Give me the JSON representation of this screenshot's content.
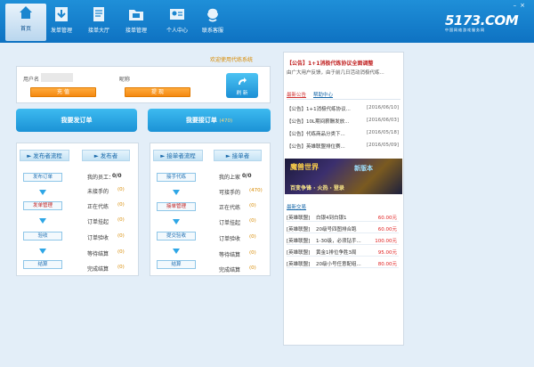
{
  "nav": [
    {
      "label": "首页",
      "icon": "home-icon"
    },
    {
      "label": "发单管理",
      "icon": "download-arrow-icon"
    },
    {
      "label": "接单大厅",
      "icon": "document-icon"
    },
    {
      "label": "接单管理",
      "icon": "folder-icon"
    },
    {
      "label": "个人中心",
      "icon": "id-card-icon"
    },
    {
      "label": "联系客服",
      "icon": "customer-service-icon"
    }
  ],
  "logo": {
    "text": "5173.COM",
    "tagline": "中国网络游戏服务网"
  },
  "welcome": "欢迎使用代练系统",
  "account": {
    "username_label": "用户名",
    "nickname_label": "昵称",
    "recharge_label": "充 值",
    "withdraw_label": "提 现",
    "refresh_label": "刷 新"
  },
  "big_buttons": {
    "publish": "我要发订单",
    "accept": "我要接订单",
    "accept_count": "(470)"
  },
  "publisher": {
    "header_flow": "发布者流程",
    "header_role": "发布者",
    "steps": [
      "发布订单",
      "发单管理",
      "验收",
      "结算"
    ],
    "stats": [
      {
        "label": "我的员工：",
        "value": "0/0"
      },
      {
        "label": "未接手的",
        "value": "(0)"
      },
      {
        "label": "正在代练",
        "value": "(0)"
      },
      {
        "label": "订单挂起",
        "value": "(0)"
      },
      {
        "label": "订单验收",
        "value": "(0)"
      },
      {
        "label": "等待结算",
        "value": "(0)"
      },
      {
        "label": "完成结算",
        "value": "(0)"
      }
    ]
  },
  "acceptor": {
    "header_flow": "接单者流程",
    "header_role": "接单者",
    "steps": [
      "接手代练",
      "接单管理",
      "提交验收",
      "结算"
    ],
    "stats": [
      {
        "label": "我的上家",
        "value": "0/0"
      },
      {
        "label": "可接手的",
        "value": "(470)"
      },
      {
        "label": "正在代练",
        "value": "(0)"
      },
      {
        "label": "订单挂起",
        "value": "(0)"
      },
      {
        "label": "订单验收",
        "value": "(0)"
      },
      {
        "label": "等待结算",
        "value": "(0)"
      },
      {
        "label": "完成结算",
        "value": "(0)"
      }
    ]
  },
  "notice": {
    "headline": "【公告】1+1消极代练协议全面调整",
    "subline": "由广大用户反馈，由于前几日活动消极代练...",
    "tab_latest": "最新公告",
    "tab_help": "帮助中心",
    "items": [
      {
        "title": "【公告】1+1消极代练协议...",
        "date": "[2016/06/10]"
      },
      {
        "title": "【公告】10L期间薪酬发放...",
        "date": "[2016/06/03]"
      },
      {
        "title": "【公告】代练商品分类下...",
        "date": "[2016/05/18]"
      },
      {
        "title": "【公告】英雄联盟排位赛...",
        "date": "[2016/05/09]"
      }
    ]
  },
  "banner": {
    "text1": "魔兽世界",
    "text2": "新版本",
    "text3": "百变争锋 · 火热 · 登录"
  },
  "trades": {
    "title": "最新交易",
    "items": [
      {
        "game": "[英雄联盟]",
        "desc": "白银4到白银1",
        "price": "60.00元"
      },
      {
        "game": "[英雄联盟]",
        "desc": "20级号四图排合跑",
        "price": "60.00元"
      },
      {
        "game": "[英雄联盟]",
        "desc": "1-30级，必须钻手...",
        "price": "100.00元"
      },
      {
        "game": "[英雄联盟]",
        "desc": "黄金1排位争胜3局",
        "price": "95.00元"
      },
      {
        "game": "[英雄联盟]",
        "desc": "20级小号任意配组...",
        "price": "80.00元"
      }
    ]
  }
}
